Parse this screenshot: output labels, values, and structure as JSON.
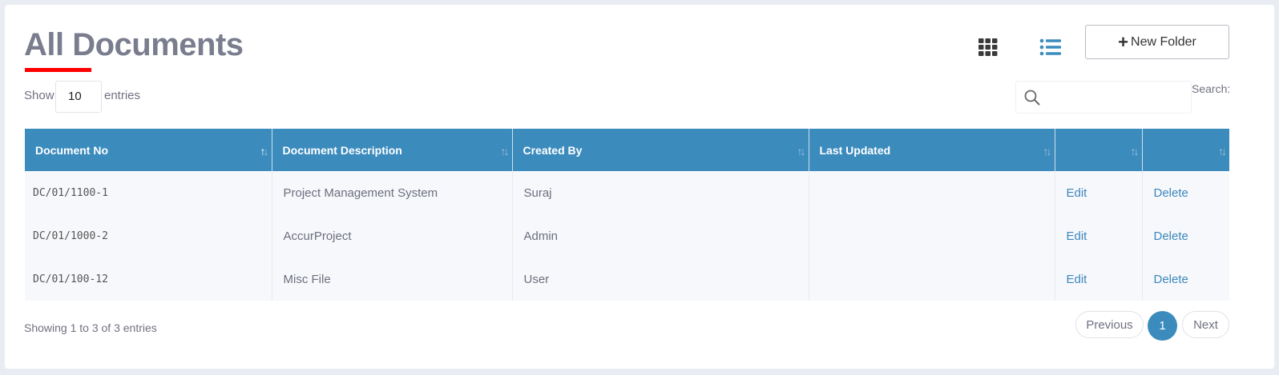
{
  "header": {
    "title": "All Documents",
    "new_folder_label": "New Folder"
  },
  "length": {
    "show_label": "Show",
    "value": "10",
    "entries_label": "entries"
  },
  "search": {
    "label": "Search:",
    "value": ""
  },
  "table": {
    "columns": [
      "Document No",
      "Document Description",
      "Created By",
      "Last Updated",
      "",
      ""
    ],
    "rows": [
      {
        "doc_no": "DC/01/1100-1",
        "description": "Project Management System",
        "created_by": "Suraj",
        "last_updated": "",
        "edit": "Edit",
        "delete": "Delete"
      },
      {
        "doc_no": "DC/01/1000-2",
        "description": "AccurProject",
        "created_by": "Admin",
        "last_updated": "",
        "edit": "Edit",
        "delete": "Delete"
      },
      {
        "doc_no": "DC/01/100-12",
        "description": "Misc File",
        "created_by": "User",
        "last_updated": "",
        "edit": "Edit",
        "delete": "Delete"
      }
    ]
  },
  "footer": {
    "info": "Showing 1 to 3 of 3 entries",
    "previous": "Previous",
    "current_page": "1",
    "next": "Next"
  },
  "colors": {
    "accent": "#3b8bbd",
    "title_underline": "#ff0000",
    "link": "#3c87bd"
  },
  "icons": {
    "grid_view": "grid-icon",
    "list_view": "list-icon",
    "new_folder": "plus-icon",
    "search": "search-icon",
    "sort": "sort-icon"
  }
}
